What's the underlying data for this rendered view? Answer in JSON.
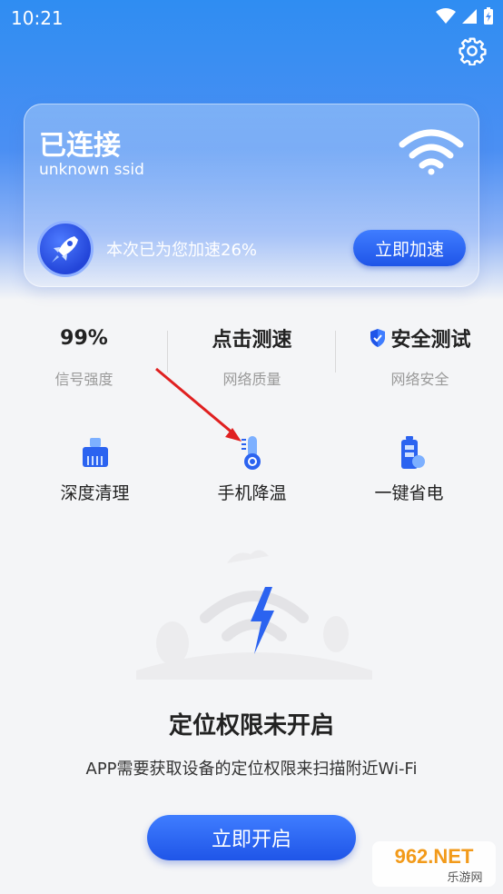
{
  "status_bar": {
    "time": "10:21"
  },
  "card": {
    "title": "已连接",
    "ssid": "unknown ssid",
    "speed_text": "本次已为您加速26%",
    "accelerate_label": "立即加速"
  },
  "stats": [
    {
      "value": "99%",
      "label": "信号强度"
    },
    {
      "value": "点击测速",
      "label": "网络质量"
    },
    {
      "value": "安全测试",
      "label": "网络安全"
    }
  ],
  "tools": [
    {
      "label": "深度清理",
      "icon": "broom-icon"
    },
    {
      "label": "手机降温",
      "icon": "thermometer-icon"
    },
    {
      "label": "一键省电",
      "icon": "battery-icon"
    }
  ],
  "permission": {
    "title": "定位权限未开启",
    "description": "APP需要获取设备的定位权限来扫描附近Wi-Fi",
    "button_label": "立即开启"
  },
  "watermark": {
    "text": "962.NET",
    "subtext": "乐游网"
  },
  "colors": {
    "accent": "#2b63f0",
    "hero_top": "#2f8df2",
    "shield": "#1f55e8"
  }
}
